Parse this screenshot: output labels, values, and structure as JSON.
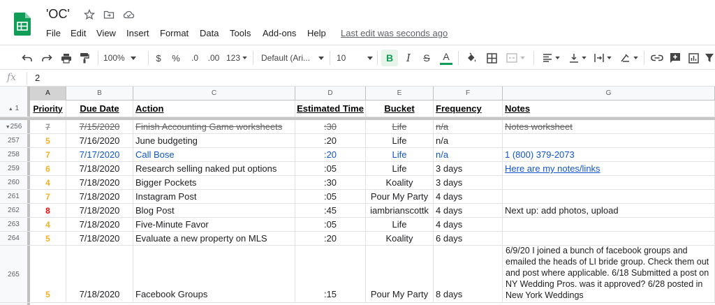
{
  "doc": {
    "title": "'OC'",
    "last_edit": "Last edit was seconds ago"
  },
  "menu": [
    "File",
    "Edit",
    "View",
    "Insert",
    "Format",
    "Data",
    "Tools",
    "Add-ons",
    "Help"
  ],
  "toolbar": {
    "zoom": "100%",
    "currency": "$",
    "percent": "%",
    "dec_less": ".0",
    "dec_more": ".00",
    "more_formats": "123",
    "font": "Default (Ari...",
    "font_size": "10",
    "bold": "B",
    "italic": "I",
    "strike": "S",
    "text_color": "A"
  },
  "formula": {
    "fx": "fx",
    "value": "2"
  },
  "columns": [
    "A",
    "B",
    "C",
    "D",
    "E",
    "F",
    "G"
  ],
  "header": {
    "row_num": "1",
    "priority": "Priority",
    "due_date": "Due Date",
    "action": "Action",
    "estimated_time": "Estimated Time",
    "bucket": "Bucket",
    "frequency": "Frequency",
    "notes": "Notes"
  },
  "rows": [
    {
      "num": "256",
      "priority": "7",
      "due": "7/15/2020",
      "action": "Finish Accounting Game worksheets",
      "time": ":30",
      "bucket": "Life",
      "freq": "n/a",
      "notes": "Notes worksheet"
    },
    {
      "num": "257",
      "priority": "5",
      "due": "7/16/2020",
      "action": "June budgeting",
      "time": ":20",
      "bucket": "Life",
      "freq": "n/a",
      "notes": ""
    },
    {
      "num": "258",
      "priority": "7",
      "due": "7/17/2020",
      "action": "Call Bose",
      "time": ":20",
      "bucket": "Life",
      "freq": "n/a",
      "notes": "1 (800) 379-2073"
    },
    {
      "num": "259",
      "priority": "6",
      "due": "7/18/2020",
      "action": "Research selling naked put options",
      "time": ":05",
      "bucket": "Life",
      "freq": "3 days",
      "notes": "Here are my notes/links"
    },
    {
      "num": "260",
      "priority": "4",
      "due": "7/18/2020",
      "action": "Bigger Pockets",
      "time": ":30",
      "bucket": "Koality",
      "freq": "3 days",
      "notes": ""
    },
    {
      "num": "261",
      "priority": "7",
      "due": "7/18/2020",
      "action": "Instagram Post",
      "time": ":05",
      "bucket": "Pour My Party",
      "freq": "4 days",
      "notes": ""
    },
    {
      "num": "262",
      "priority": "8",
      "due": "7/18/2020",
      "action": "Blog Post",
      "time": ":45",
      "bucket": "iambrianscottk",
      "freq": "4 days",
      "notes": "Next up: add photos, upload"
    },
    {
      "num": "263",
      "priority": "4",
      "due": "7/18/2020",
      "action": "Five-Minute Favor",
      "time": ":05",
      "bucket": "Life",
      "freq": "4 days",
      "notes": ""
    },
    {
      "num": "264",
      "priority": "5",
      "due": "7/18/2020",
      "action": "Evaluate a new property on MLS",
      "time": ":20",
      "bucket": "Koality",
      "freq": "6 days",
      "notes": ""
    },
    {
      "num": "265",
      "priority": "5",
      "due": "7/18/2020",
      "action": "Facebook Groups",
      "time": ":15",
      "bucket": "Pour My Party",
      "freq": "8 days",
      "notes": "6/9/20 I joined a bunch of facebook groups and emailed the heads of LI bride group. Check them out and post where applicable. 6/18 Submitted a post on NY Wedding Pros. was it approved? 6/28 posted in New York Weddings"
    }
  ],
  "colors": {
    "priority_orange": "#f6b026",
    "priority_red": "#ff0000",
    "link_blue": "#1155cc",
    "sheets_green": "#0f9d58"
  }
}
